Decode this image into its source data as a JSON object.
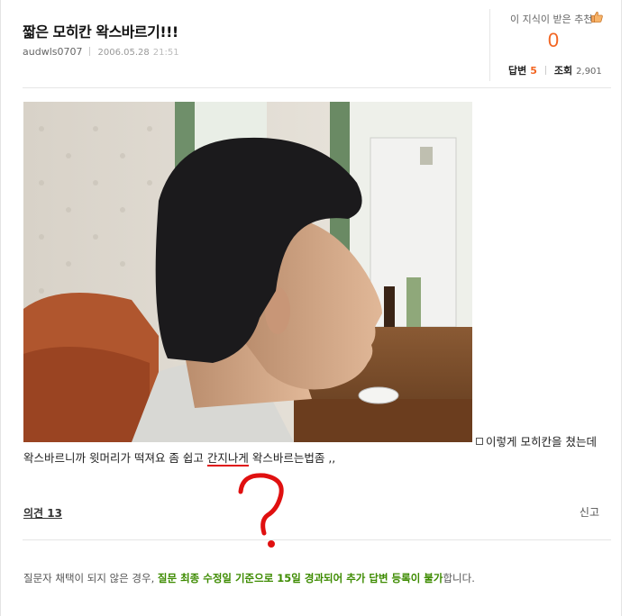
{
  "question": {
    "title": "짧은 모히칸 왁스바르기!!!",
    "author": "audwls0707",
    "date": "2006.05.28",
    "time": "21:51"
  },
  "recommend": {
    "label": "이 지식이 받은 추천",
    "count": "0",
    "icon": "thumbs-up-icon"
  },
  "stats": {
    "answers_label": "답변",
    "answers_count": "5",
    "views_label": "조회",
    "views_count": "2,901"
  },
  "body": {
    "caption_line1": "이렇게 모히칸을 쳤는데",
    "caption_line2_a": "왁스바르니까 윗머리가 떡져요 좀 쉽고 ",
    "caption_line2_u": "간지나게",
    "caption_line2_b": " 왁스바르는법좀 ,,",
    "annotation": "?"
  },
  "footer": {
    "opinion": "의견 13",
    "report": "신고",
    "notice_prefix": "질문자 채택이 되지 않은 경우, ",
    "notice_bold": "질문 최종 수정일 기준으로 15일 경과되어 추가 답변 등록이 불가",
    "notice_suffix": "합니다."
  },
  "colors": {
    "accent": "#f26522",
    "notice_green": "#3d8b00",
    "annotation_red": "#e01010"
  }
}
